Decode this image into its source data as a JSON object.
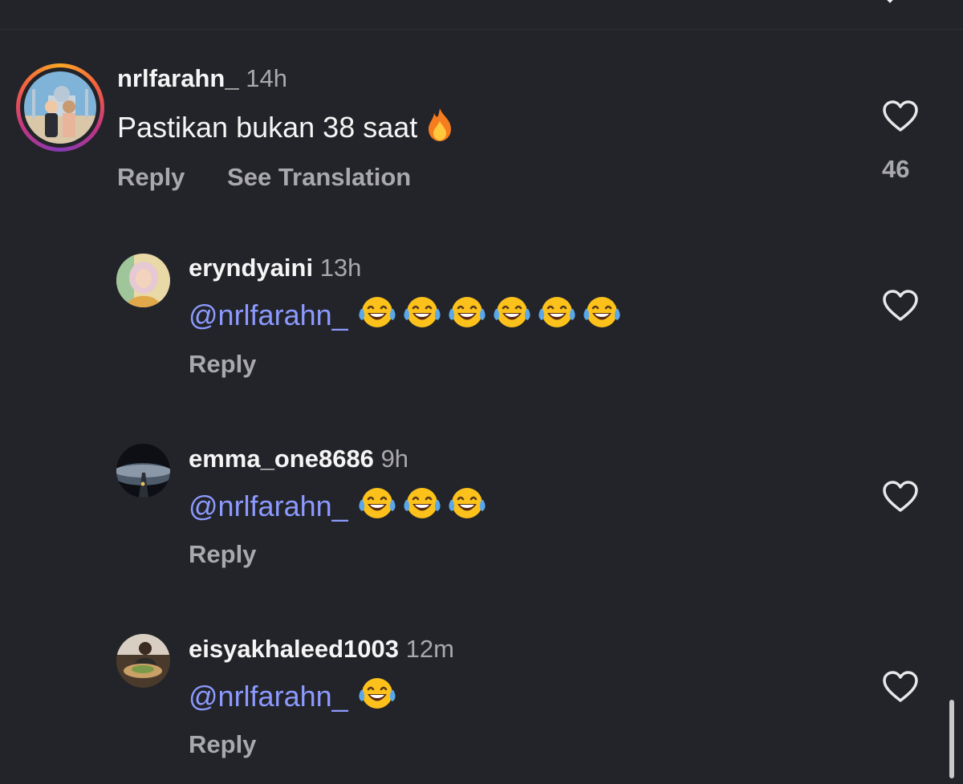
{
  "comments": [
    {
      "username": "nrlfarahn_",
      "time": "14h",
      "text": "Pastikan bukan 38 saat",
      "emoji": "fire-emoji",
      "actions": [
        "Reply",
        "See Translation"
      ],
      "likes": "46",
      "avatar": "avatar-couple-mosque"
    }
  ],
  "replies": [
    {
      "username": "eryndyaini",
      "time": "13h",
      "mention": "@nrlfarahn_",
      "emoji_count": 6,
      "emoji": "laughing-tears-emoji",
      "reply_label": "Reply",
      "avatar": "avatar-hijab-woman"
    },
    {
      "username": "emma_one8686",
      "time": "9h",
      "mention": "@nrlfarahn_",
      "emoji_count": 3,
      "emoji": "laughing-tears-emoji",
      "reply_label": "Reply",
      "avatar": "avatar-planet-road"
    },
    {
      "username": "eisyakhaleed1003",
      "time": "12m",
      "mention": "@nrlfarahn_",
      "emoji_count": 1,
      "emoji": "laughing-tears-emoji",
      "reply_label": "Reply",
      "avatar": "avatar-food-table"
    }
  ],
  "colors": {
    "background": "#232429",
    "mention": "#8c9aff",
    "secondary_text": "#a8a8ad"
  }
}
